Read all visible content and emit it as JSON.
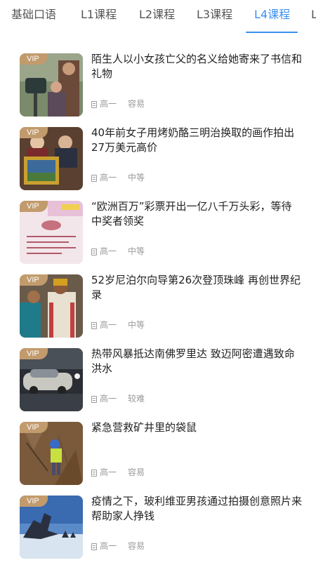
{
  "tabs": [
    {
      "label": "基础口语"
    },
    {
      "label": "L1课程"
    },
    {
      "label": "L2课程"
    },
    {
      "label": "L3课程"
    },
    {
      "label": "L4课程",
      "active": true
    },
    {
      "label": "L"
    }
  ],
  "accent_color": "#3a8ff0",
  "vip_badge_color": "#c29b6d",
  "articles": [
    {
      "badge": "VIP",
      "title": "陌生人以小女孩亡父的名义给她寄来了书信和礼物",
      "level": "高一",
      "difficulty": "容易",
      "icon": "document-icon"
    },
    {
      "badge": "VIP",
      "title": "40年前女子用烤奶酪三明治换取的画作拍出27万美元高价",
      "level": "高一",
      "difficulty": "中等",
      "icon": "document-icon"
    },
    {
      "badge": "VIP",
      "title": "“欧洲百万”彩票开出一亿八千万头彩，等待中奖者领奖",
      "level": "高一",
      "difficulty": "中等",
      "icon": "document-icon"
    },
    {
      "badge": "VIP",
      "title": "52岁尼泊尔向导第26次登顶珠峰 再创世界纪录",
      "level": "高一",
      "difficulty": "中等",
      "icon": "document-icon"
    },
    {
      "badge": "VIP",
      "title": "热带风暴抵达南佛罗里达 致迈阿密遭遇致命洪水",
      "level": "高一",
      "difficulty": "较难",
      "icon": "document-icon"
    },
    {
      "badge": "VIP",
      "title": "紧急营救矿井里的袋鼠",
      "level": "高一",
      "difficulty": "容易",
      "icon": "document-icon"
    },
    {
      "badge": "VIP",
      "title": "疫情之下，玻利维亚男孩通过拍摄创意照片来帮助家人挣钱",
      "level": "高一",
      "difficulty": "容易",
      "icon": "document-icon"
    }
  ]
}
